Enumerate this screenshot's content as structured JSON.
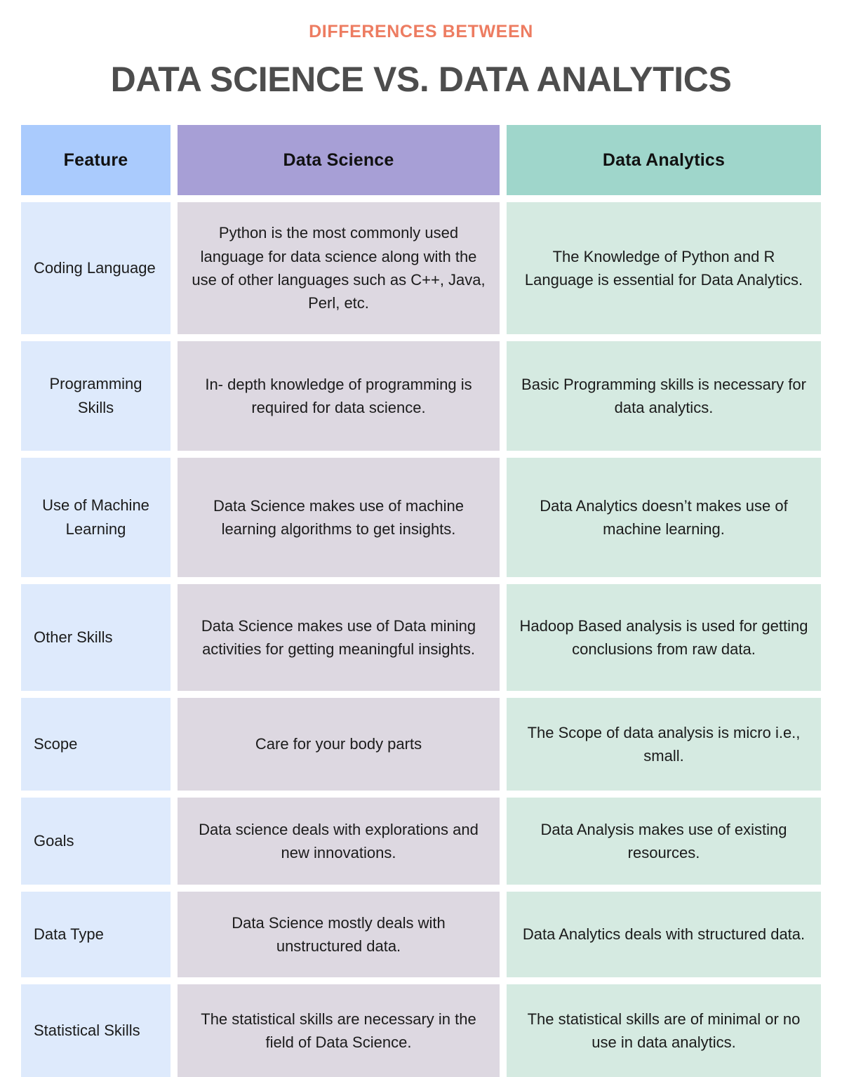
{
  "header": {
    "kicker": "Differences Between",
    "title": "Data Science vs. Data Analytics",
    "kicker_color": "#ED7C61",
    "title_color": "#4D4D4D"
  },
  "table": {
    "columns": [
      {
        "key": "feature",
        "label": "Feature",
        "header_color": "#AACBFD",
        "body_color": "#DEEAFC"
      },
      {
        "key": "science",
        "label": "Data Science",
        "header_color": "#A79FD6",
        "body_color": "#DDD8E1"
      },
      {
        "key": "analytics",
        "label": "Data Analytics",
        "header_color": "#9FD6CB",
        "body_color": "#D5EAE1"
      }
    ],
    "rows": [
      {
        "feature": "Coding Language",
        "science": "Python is the most commonly used language for data science along with the use of other languages such as C++, Java, Perl, etc.",
        "analytics": "The Knowledge of Python and R Language is essential for Data Analytics."
      },
      {
        "feature": "Programming Skills",
        "science": "In- depth knowledge of programming is required for data science.",
        "analytics": "Basic Programming skills is necessary for data analytics."
      },
      {
        "feature": "Use of Machine Learning",
        "science": "Data Science makes use of machine learning algorithms to get insights.",
        "analytics": "Data Analytics doesn’t makes use of machine learning."
      },
      {
        "feature": "Other Skills",
        "science": "Data Science makes use of Data mining activities for getting meaningful insights.",
        "analytics": "Hadoop Based analysis is used for getting conclusions from raw data."
      },
      {
        "feature": "Scope",
        "science": "Care for your body parts",
        "analytics": "The Scope of data analysis is micro i.e., small."
      },
      {
        "feature": "Goals",
        "science": "Data science deals with explorations and new innovations.",
        "analytics": "Data Analysis makes use of existing resources."
      },
      {
        "feature": "Data Type",
        "science": "Data Science mostly deals with unstructured data.",
        "analytics": "Data Analytics deals with structured data."
      },
      {
        "feature": "Statistical Skills",
        "science": "The statistical skills are necessary in the field of Data Science.",
        "analytics": "The statistical skills are of minimal or no use in data analytics."
      }
    ]
  }
}
